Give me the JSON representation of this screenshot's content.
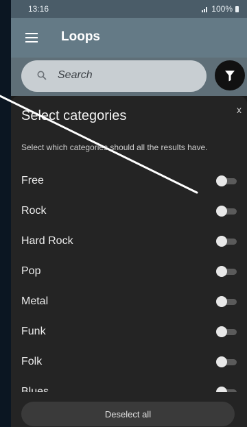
{
  "status_bar": {
    "time": "13:16",
    "battery": "100%"
  },
  "app_bar": {
    "title": "Loops"
  },
  "search": {
    "placeholder": "Search"
  },
  "sheet": {
    "close_label": "x",
    "title": "Select categories",
    "subtitle": "Select which categories should all the results have.",
    "categories": [
      {
        "label": "Free",
        "enabled": false
      },
      {
        "label": "Rock",
        "enabled": false
      },
      {
        "label": "Hard Rock",
        "enabled": false
      },
      {
        "label": "Pop",
        "enabled": false
      },
      {
        "label": "Metal",
        "enabled": false
      },
      {
        "label": "Funk",
        "enabled": false
      },
      {
        "label": "Folk",
        "enabled": false
      },
      {
        "label": "Blues",
        "enabled": false
      }
    ],
    "deselect_label": "Deselect all"
  },
  "colors": {
    "app_bar": "#647a86",
    "sheet_background": "#242424",
    "toggle_thumb": "#e8e8e8",
    "toggle_track": "#5b5b5b"
  }
}
